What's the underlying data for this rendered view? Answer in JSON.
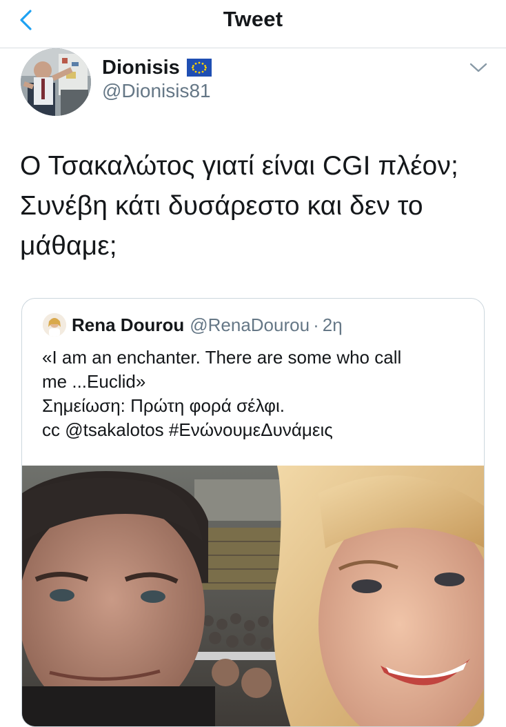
{
  "nav": {
    "title": "Tweet",
    "back_icon": "chevron-left-icon",
    "accent": "#1da1f2"
  },
  "author": {
    "name": "Dionisis",
    "flag_icon": "eu-flag-icon",
    "handle": "@Dionisis81",
    "menu_icon": "chevron-down-icon"
  },
  "tweet": {
    "text": "Ο Τσακαλώτος γιατί είναι CGI πλέον;\nΣυνέβη κάτι δυσάρεστο και δεν το\nμάθαμε;"
  },
  "quoted": {
    "name": "Rena Dourou",
    "handle": "@RenaDourou",
    "separator": "·",
    "time": "2η",
    "text": "«I am an enchanter. There are some who call\nme ...Euclid»\nΣημείωση: Πρώτη φορά σέλφι.\ncc @tsakalotos #ΕνώνουμεΔυνάμεις"
  },
  "colors": {
    "text_primary": "#14171a",
    "text_secondary": "#657786",
    "border": "#ccd6dd"
  }
}
